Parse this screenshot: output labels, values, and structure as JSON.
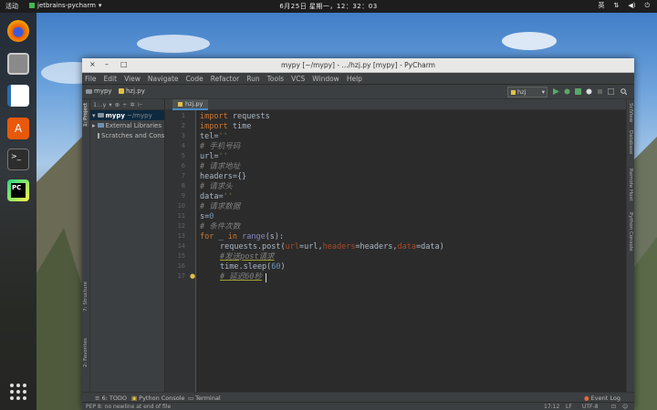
{
  "topbar": {
    "activities": "活动",
    "app_name": "jetbrains-pycharm",
    "clock": "6月25日 星期一，12：32：03",
    "input_method": "英"
  },
  "window": {
    "title": "mypy [~/mypy] - .../hzj.py [mypy] - PyCharm"
  },
  "menu": [
    "File",
    "Edit",
    "View",
    "Navigate",
    "Code",
    "Refactor",
    "Run",
    "Tools",
    "VCS",
    "Window",
    "Help"
  ],
  "navbar": {
    "crumb_project": "mypy",
    "crumb_file": "hzj.py",
    "run_config": "hzj"
  },
  "project_panel": {
    "tool_label": "1:..y",
    "side_label": "1: Project",
    "items": [
      {
        "name": "mypy",
        "path": "~/mypy"
      },
      {
        "name": "External Libraries",
        "path": ""
      },
      {
        "name": "Scratches and Consoles",
        "path": ""
      }
    ]
  },
  "left_strip": {
    "structure": "7: Structure",
    "favorites": "2: Favorites"
  },
  "right_strip": [
    "SciView",
    "Database",
    "Remote Host",
    "Python Console"
  ],
  "editor": {
    "tab": "hzj.py",
    "line_numbers": [
      "1",
      "2",
      "3",
      "4",
      "5",
      "6",
      "7",
      "8",
      "9",
      "10",
      "11",
      "12",
      "13",
      "14",
      "15",
      "16",
      "17"
    ]
  },
  "code_tokens": {
    "import": "import",
    "requests": " requests",
    "time": " time",
    "tel": "tel=",
    "empty_str": "''",
    "c_phone": "# 手机号码",
    "url": "url=",
    "c_url": "# 请求地址",
    "headers": "headers={}",
    "c_headers": "# 请求头",
    "data": "data=",
    "c_data": "# 请求数据",
    "s": "s=",
    "zero": "0",
    "c_count": "# 条件次数",
    "for": "for",
    "in": " in ",
    "range": "range",
    "range_arg": "(s):",
    "post_prefix": "requests.post(",
    "p_url": "url",
    "eq_url": "=url,",
    "p_headers": "headers",
    "eq_headers": "=headers,",
    "p_data": "data",
    "eq_data": "=data)",
    "c_post": "#发送post请求",
    "sleep_prefix": "time.sleep(",
    "sixty": "60",
    "close_paren": ")",
    "c_delay": "# 延迟60秒"
  },
  "bottom_tools": [
    "6: TODO",
    "Python Console",
    "Terminal",
    "Event Log"
  ],
  "status": {
    "message": "PEP 8: no newline at end of file",
    "position": "17:12",
    "line_sep": "LF",
    "encoding": "UTF-8"
  },
  "colors": {
    "keyword": "#cc7832",
    "string": "#6a8759",
    "number": "#6897bb",
    "comment": "#808080",
    "param": "#aa4926"
  }
}
